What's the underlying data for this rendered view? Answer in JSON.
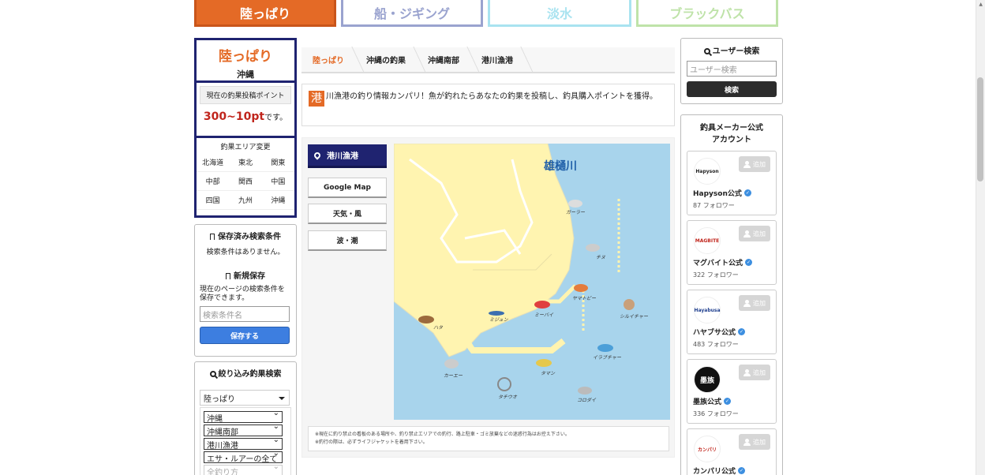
{
  "tabs": {
    "land": "陸っぱり",
    "boat": "船・ジギング",
    "fresh": "淡水",
    "bass": "ブラックバス"
  },
  "left": {
    "mode": "陸っぱり",
    "area": "沖縄",
    "points_label": "現在の釣果投稿ポイント",
    "points_value": "300~10pt",
    "points_suffix": "です。",
    "area_change_title": "釣果エリア変更",
    "areas": [
      "北海道",
      "東北",
      "関東",
      "中部",
      "関西",
      "中国",
      "四国",
      "九州",
      "沖縄"
    ]
  },
  "saved": {
    "title": "保存済み検索条件",
    "empty": "検索条件はありません。",
    "new_title": "新規保存",
    "desc": "現在のページの検索条件を保存できます。",
    "input_placeholder": "検索条件名",
    "save_button": "保存する"
  },
  "filter": {
    "title": "絞り込み釣果検索",
    "mode": "陸っぱり",
    "selects": [
      "沖縄",
      "沖縄南部",
      "港川漁港",
      "エサ・ルアーの全て",
      "全釣り方"
    ]
  },
  "breadcrumb": [
    "陸っぱり",
    "沖縄の釣果",
    "沖縄南部",
    "港川漁港"
  ],
  "intro": {
    "first_char": "港",
    "text": "川漁港の釣り情報カンパリ！魚が釣れたらあなたの釣果を投稿し、釣具購入ポイントを獲得。"
  },
  "map_panel": {
    "spot": "港川漁港",
    "buttons": [
      "Google Map",
      "天気・風",
      "波・潮"
    ],
    "river_label": "雄樋川",
    "fish": [
      "ガーラー",
      "チヌ",
      "ヤマトビー",
      "シルイチャー",
      "ミーバイ",
      "ミジュン",
      "ハタ",
      "イラブチャー",
      "カーエー",
      "タマン",
      "タチウオ",
      "コロダイ"
    ],
    "notes": [
      "※現在に釣り禁止の看板のある場所や、釣り禁止エリアでの釣行、路上駐車・ゴミ放棄などの迷惑行為はお控え下さい。",
      "※釣行の際は、必ずライフジャケットを着用下さい。"
    ]
  },
  "user_search": {
    "title": "ユーザー検索",
    "placeholder": "ユーザー検索",
    "button": "検索"
  },
  "makers": {
    "title": "釣具メーカー公式アカウント",
    "follow_label": "追加",
    "items": [
      {
        "name": "Hapyson公式",
        "count": "87 フォロワー",
        "logo": "Hapyson"
      },
      {
        "name": "マグバイト公式",
        "count": "322 フォロワー",
        "logo": "MAGBITE"
      },
      {
        "name": "ハヤブサ公式",
        "count": "483 フォロワー",
        "logo": "Hayabusa"
      },
      {
        "name": "墨族公式",
        "count": "336 フォロワー",
        "logo": "墨族"
      },
      {
        "name": "カンパリ公式",
        "count": "",
        "logo": "カンパリ"
      }
    ]
  }
}
